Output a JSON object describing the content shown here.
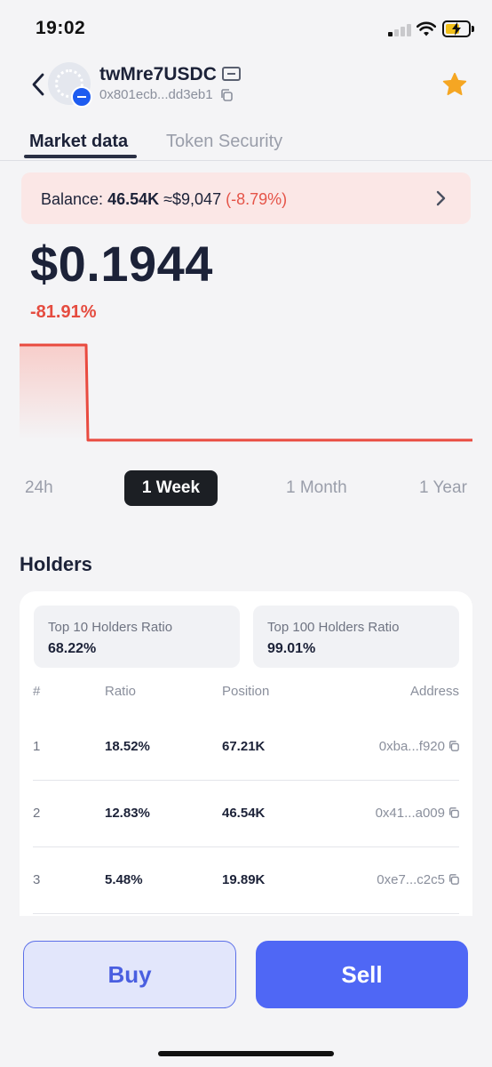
{
  "status_bar": {
    "time": "19:02"
  },
  "header": {
    "token_name": "twMre7USDC",
    "token_address": "0x801ecb...dd3eb1"
  },
  "tabs": [
    {
      "label": "Market data",
      "active": true
    },
    {
      "label": "Token Security",
      "active": false
    }
  ],
  "balance": {
    "label": "Balance:",
    "amount": "46.54K",
    "value": "≈$9,047",
    "change": "(-8.79%)"
  },
  "price": {
    "value": "$0.1944",
    "change": "-81.91%"
  },
  "chart": {
    "line_color": "#e94a3f",
    "range_options": [
      "24h",
      "1 Week",
      "1 Month",
      "1 Year"
    ],
    "selected_range": "1 Week"
  },
  "holders": {
    "title": "Holders",
    "top10": {
      "label": "Top 10 Holders Ratio",
      "value": "68.22%"
    },
    "top100": {
      "label": "Top 100 Holders Ratio",
      "value": "99.01%"
    },
    "columns": [
      "#",
      "Ratio",
      "Position",
      "Address"
    ],
    "rows": [
      {
        "rank": "1",
        "ratio": "18.52%",
        "position": "67.21K",
        "address": "0xba...f920"
      },
      {
        "rank": "2",
        "ratio": "12.83%",
        "position": "46.54K",
        "address": "0x41...a009"
      },
      {
        "rank": "3",
        "ratio": "5.48%",
        "position": "19.89K",
        "address": "0xe7...c2c5"
      }
    ]
  },
  "actions": {
    "buy": "Buy",
    "sell": "Sell"
  },
  "colors": {
    "accent": "#4f67f5",
    "negative": "#e54c40",
    "star": "#f5a623"
  }
}
